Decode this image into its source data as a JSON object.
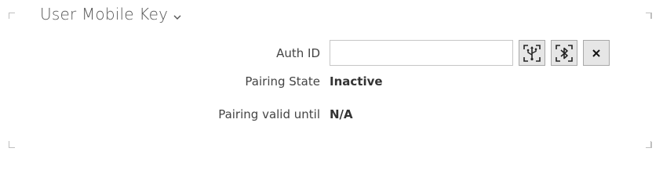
{
  "section": {
    "title": "User Mobile Key"
  },
  "fields": {
    "auth_id": {
      "label": "Auth ID",
      "value": "",
      "placeholder": ""
    },
    "pairing_state": {
      "label": "Pairing State",
      "value": "Inactive"
    },
    "pairing_valid_until": {
      "label": "Pairing valid until",
      "value": "N/A"
    }
  },
  "buttons": {
    "usb_pair_icon": "usb-pair-icon",
    "bluetooth_pair_icon": "bluetooth-pair-icon",
    "clear_icon": "close-icon"
  }
}
